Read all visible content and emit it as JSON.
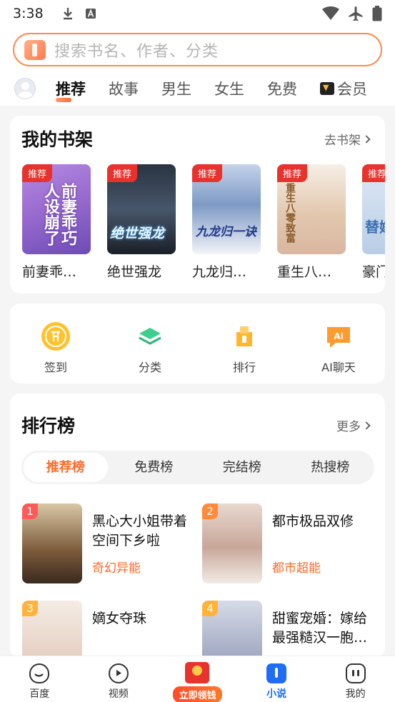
{
  "status": {
    "time": "3:38",
    "left_icons": [
      "download-icon",
      "notification-a-icon"
    ],
    "right_icons": [
      "wifi-icon",
      "airplane-icon",
      "battery-icon"
    ]
  },
  "search": {
    "placeholder": "搜索书名、作者、分类",
    "icon": "book-logo-icon"
  },
  "tabs": [
    {
      "label": "推荐",
      "active": true
    },
    {
      "label": "故事"
    },
    {
      "label": "男生"
    },
    {
      "label": "女生"
    },
    {
      "label": "免费"
    },
    {
      "label": "会员",
      "icon": "vip-icon"
    }
  ],
  "shelf": {
    "title": "我的书架",
    "link": "去书架",
    "books": [
      {
        "title": "前妻乖…",
        "badge": "推荐",
        "cover_text": "前妻乖巧人设崩了"
      },
      {
        "title": "绝世强龙",
        "badge": "推荐",
        "cover_text": "绝世强龙"
      },
      {
        "title": "九龙归…",
        "badge": "推荐",
        "cover_text": "九龙归一诀"
      },
      {
        "title": "重生八…",
        "badge": "推荐",
        "cover_text": "重生八零致富"
      },
      {
        "title": "豪门…",
        "badge": "推荐",
        "cover_text": "替嫁"
      }
    ]
  },
  "quick_actions": [
    {
      "label": "签到",
      "icon": "coin-icon"
    },
    {
      "label": "分类",
      "icon": "layers-icon"
    },
    {
      "label": "排行",
      "icon": "rank-icon"
    },
    {
      "label": "AI聊天",
      "icon": "ai-chat-icon"
    }
  ],
  "ranking": {
    "title": "排行榜",
    "link": "更多",
    "tabs": [
      {
        "label": "推荐榜",
        "active": true
      },
      {
        "label": "免费榜"
      },
      {
        "label": "完结榜"
      },
      {
        "label": "热搜榜"
      }
    ],
    "items": [
      {
        "rank": "1",
        "title": "黑心大小姐带着空间下乡啦",
        "genre": "奇幻异能"
      },
      {
        "rank": "2",
        "title": "都市极品双修",
        "genre": "都市超能"
      },
      {
        "rank": "3",
        "title": "嫡女夺珠",
        "genre": ""
      },
      {
        "rank": "4",
        "title": "甜蜜宠婚：嫁给最强糙汉一胞…",
        "genre": ""
      }
    ]
  },
  "bottom_nav": [
    {
      "label": "百度",
      "icon": "baidu-face-icon"
    },
    {
      "label": "视频",
      "icon": "video-play-icon"
    },
    {
      "label": "立即领钱",
      "icon": "red-envelope-icon"
    },
    {
      "label": "小说",
      "icon": "novel-book-icon",
      "active": true
    },
    {
      "label": "我的",
      "icon": "profile-face-icon"
    }
  ],
  "colors": {
    "accent": "#ff6a2a",
    "badge_red": "#e8322e",
    "nav_active": "#1f6cf5",
    "search_border": "#ff8a4c"
  }
}
